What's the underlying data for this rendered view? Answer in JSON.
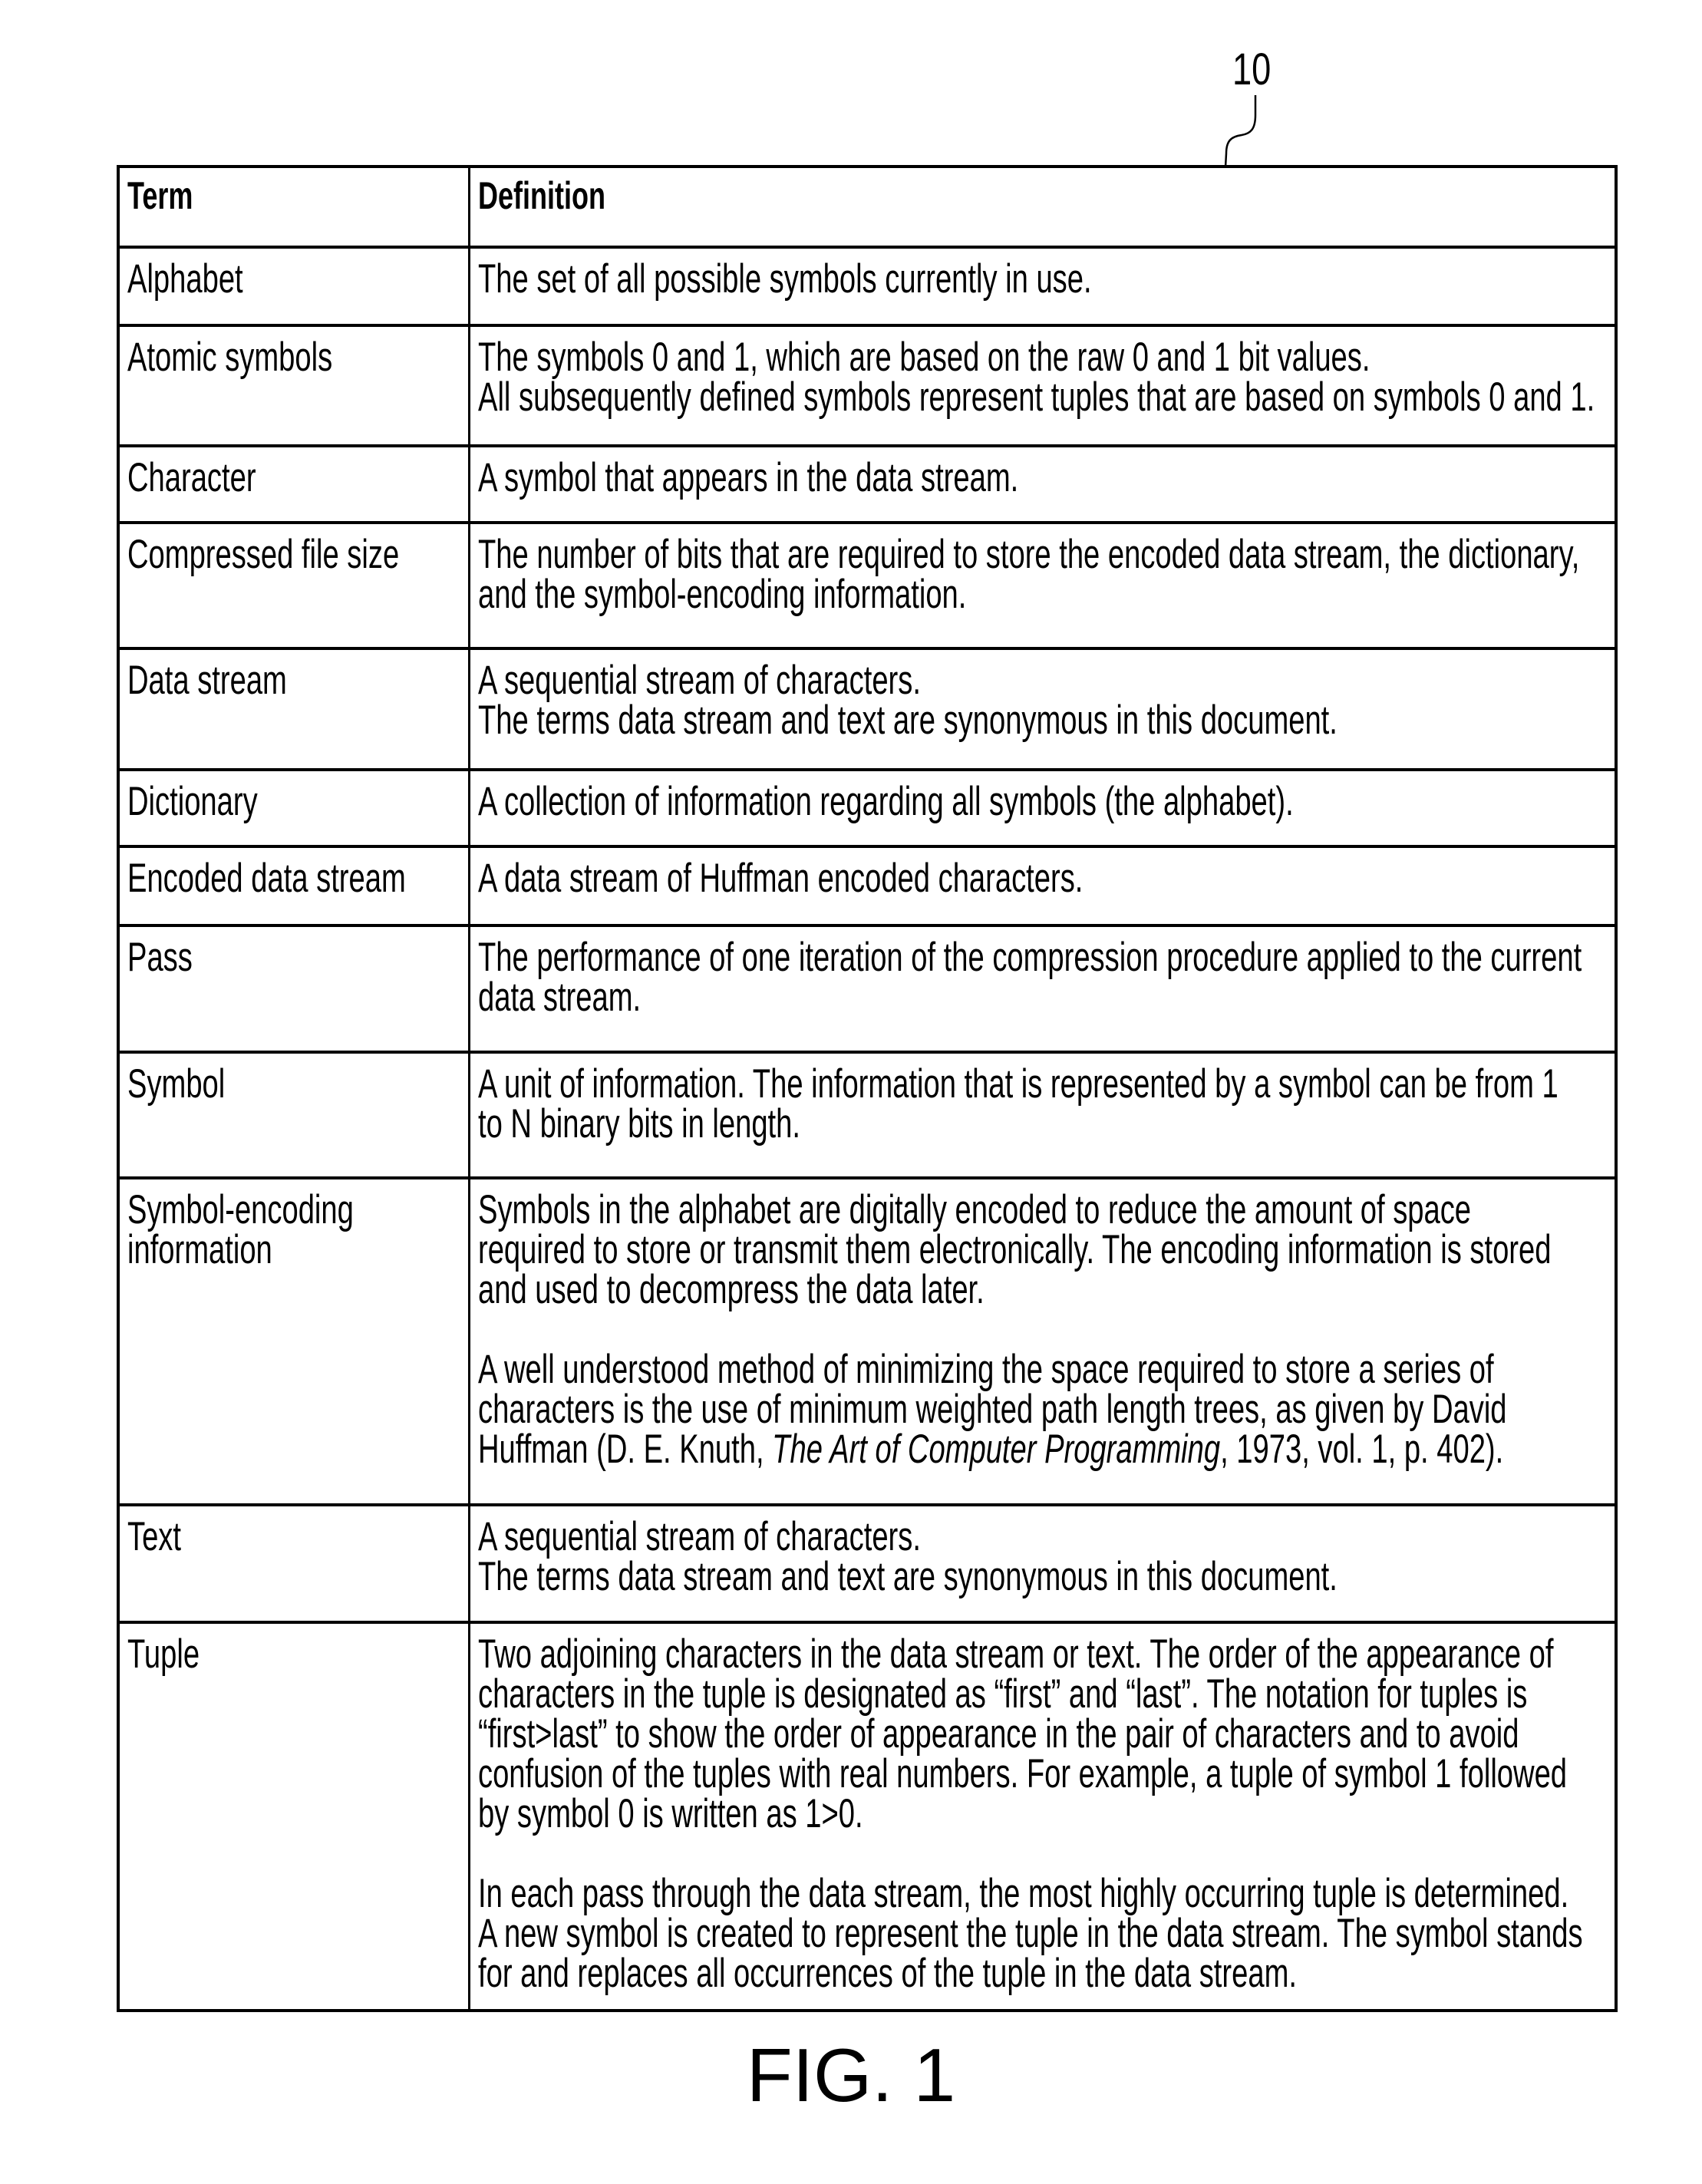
{
  "figure": {
    "reference_numeral": "10",
    "caption": "FIG. 1"
  },
  "table": {
    "headers": {
      "term": "Term",
      "definition": "Definition"
    },
    "rows": [
      {
        "term": [
          "Alphabet"
        ],
        "definition": [
          [
            "The set of all possible symbols currently in use."
          ]
        ]
      },
      {
        "term": [
          "Atomic symbols"
        ],
        "definition": [
          [
            "The symbols 0 and 1, which are based on the raw 0 and 1 bit values.",
            "All subsequently defined symbols represent tuples that are based on symbols 0 and 1."
          ]
        ]
      },
      {
        "term": [
          "Character"
        ],
        "definition": [
          [
            "A symbol that appears in the data stream."
          ]
        ]
      },
      {
        "term": [
          "Compressed file size"
        ],
        "definition": [
          [
            "The number of bits that are required to store the encoded data stream, the dictionary,",
            "and the symbol-encoding information."
          ]
        ]
      },
      {
        "term": [
          "Data stream"
        ],
        "definition": [
          [
            "A sequential stream of characters.",
            "The terms data stream and text are synonymous in this document."
          ]
        ]
      },
      {
        "term": [
          "Dictionary"
        ],
        "definition": [
          [
            "A collection of information regarding all symbols (the alphabet)."
          ]
        ]
      },
      {
        "term": [
          "Encoded data stream"
        ],
        "definition": [
          [
            "A data stream of Huffman encoded characters."
          ]
        ]
      },
      {
        "term": [
          "Pass"
        ],
        "definition": [
          [
            "The performance of one iteration of the compression procedure applied to the current",
            "data stream."
          ]
        ]
      },
      {
        "term": [
          "Symbol"
        ],
        "definition": [
          [
            "A unit of information. The information that is represented by a symbol can be from 1",
            "to N binary bits in length."
          ]
        ]
      },
      {
        "term": [
          "Symbol-encoding",
          "information"
        ],
        "definition": [
          [
            "Symbols in the alphabet are digitally encoded to reduce the amount of space",
            "required to store or transmit them electronically. The encoding information is stored",
            "and used to decompress the data later."
          ],
          [
            "A well understood method of minimizing the space required to store a series of",
            "characters is the use of minimum weighted path length trees, as given by David",
            "Huffman (D. E. Knuth, The Art of Computer Programming, 1973, vol. 1, p. 402)."
          ]
        ],
        "italic_phrase": "The Art of Computer Programming"
      },
      {
        "term": [
          "Text"
        ],
        "definition": [
          [
            "A sequential stream of characters.",
            "The terms data stream and text are synonymous in this document."
          ]
        ]
      },
      {
        "term": [
          "Tuple"
        ],
        "definition": [
          [
            "Two adjoining characters in the data stream or text. The order of the appearance of",
            "characters in the tuple is designated as “first” and “last”. The notation for tuples is",
            "“first>last” to show the order of appearance in the pair of characters and to avoid",
            "confusion of the tuples with real numbers. For example, a tuple of symbol 1 followed",
            "by symbol 0 is written as 1>0."
          ],
          [
            "In each pass through the data stream, the most highly occurring tuple is determined.",
            "A new symbol is created to represent the tuple in the data stream. The symbol stands",
            "for and replaces all occurrences of the tuple in the data stream."
          ]
        ]
      }
    ]
  }
}
